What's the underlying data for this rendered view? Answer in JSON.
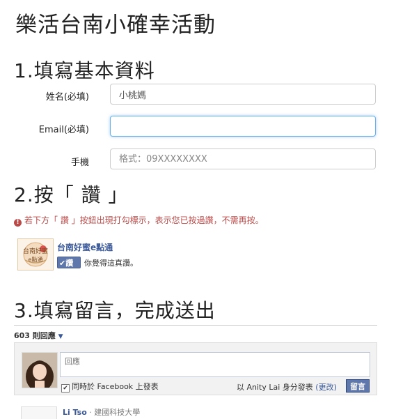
{
  "page_title": "樂活台南小確幸活動",
  "step1": {
    "heading": "1.填寫基本資料",
    "fields": [
      {
        "label": "姓名(必填)",
        "value": "小桃媽",
        "placeholder": ""
      },
      {
        "label": "Email(必填)",
        "value": "",
        "placeholder": ""
      },
      {
        "label": "手機",
        "value": "",
        "placeholder": "格式：09XXXXXXXX"
      }
    ]
  },
  "step2": {
    "heading": "2.按「 讚 」",
    "warning": "若下方「 讚 」按鈕出現打勾標示，表示您已按過讚，不需再按。",
    "fb_page_name": "台南好蜜e點通",
    "logo_text": "台南好蜜 e點通",
    "like_button": "讚",
    "like_text": "你覺得這真讚。"
  },
  "step3": {
    "heading": "3.填寫留言，完成送出",
    "comment_count": "603 則回應",
    "comment_placeholder": "回應",
    "also_post": "同時於 Facebook 上發表",
    "post_as_prefix": "以 Anity Lai 身分發表",
    "change_link": "(更改)",
    "post_button": "留言",
    "first_commenter_name": "Li Tso",
    "first_commenter_school": "· 建國科技大學"
  },
  "colors": {
    "fb_blue": "#3b5998",
    "like_button": "#5f78ab",
    "warning": "#b94a48",
    "focus_border": "#66afe9"
  }
}
